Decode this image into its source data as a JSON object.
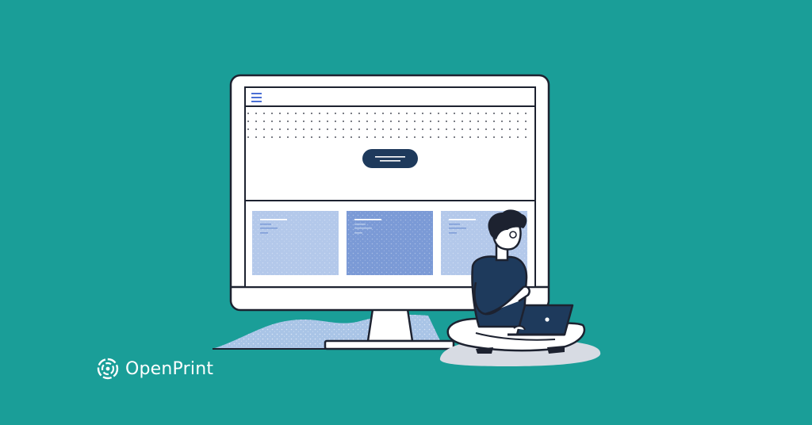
{
  "brand": {
    "name": "OpenPrint",
    "logo_icon": "openprint-logo-icon"
  },
  "colors": {
    "background": "#1a9e98",
    "outline": "#1d2230",
    "navy": "#1e3a5c",
    "card_light": "#b3c8ea",
    "card_mid": "#7b9ad6",
    "menu_icon": "#4a6fd4",
    "ground": "#d7dbe3",
    "skin": "#ffffff",
    "hair": "#1d2230"
  },
  "illustration": {
    "monitor": {
      "menu_icon": "hamburger-menu-icon",
      "hero_button_icon": "text-lines-icon",
      "cards": [
        "light",
        "mid",
        "light"
      ]
    },
    "person_with_laptop": true
  }
}
